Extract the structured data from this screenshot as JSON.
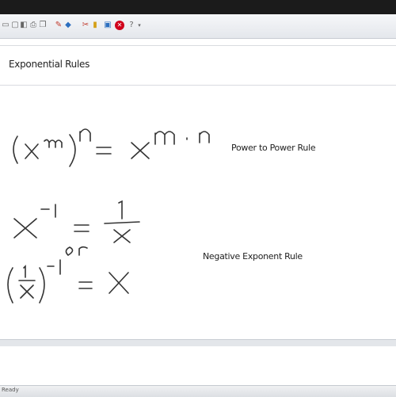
{
  "page": {
    "title": "Exponential Rules",
    "status": "Ready"
  },
  "toolbar_icons": [
    "new-icon",
    "open-icon",
    "save-icon",
    "print-icon",
    "copy-icon",
    "paste-icon",
    "pen-icon",
    "highlighter-icon",
    "eraser-icon",
    "select-icon",
    "undo-icon",
    "help-icon"
  ],
  "rules": [
    {
      "label": "Power to Power Rule"
    },
    {
      "label": "Negative Exponent Rule"
    }
  ],
  "math": {
    "base": "X",
    "exp_m": "m",
    "exp_n": "n",
    "product": "m · n",
    "neg_one": "−1",
    "one": "1",
    "or": "or"
  }
}
